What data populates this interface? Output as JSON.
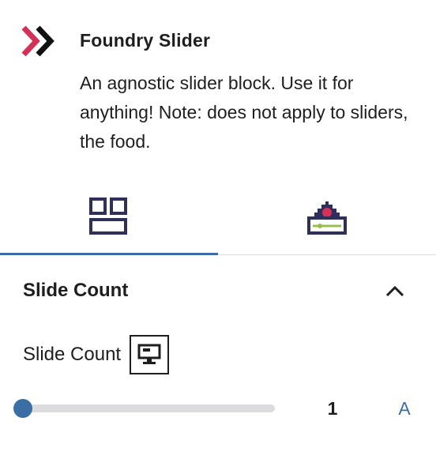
{
  "block_card": {
    "title": "Foundry Slider",
    "description": "An agnostic slider block. Use it for anything! Note: does not apply to sliders, the food.",
    "icon": "double-chevron-right-icon",
    "accent_color": "#d33156"
  },
  "tabs": [
    {
      "icon": "layout-grid-icon",
      "active": true
    },
    {
      "icon": "settings-gear-slider-icon",
      "active": false
    }
  ],
  "panel": {
    "title": "Slide Count",
    "expanded": true,
    "toggle_icon": "chevron-up-icon",
    "control": {
      "label": "Slide Count",
      "device_icon": "desktop-icon",
      "range": {
        "min": 1,
        "max": 10,
        "value": "1",
        "unit_toggle": "A"
      }
    }
  },
  "colors": {
    "primary": "#3a6ea5",
    "text": "#1e1e1e",
    "track": "#dcdcde",
    "tab_icon": "#2f2f5c",
    "accent_green": "#9bbf4c"
  }
}
